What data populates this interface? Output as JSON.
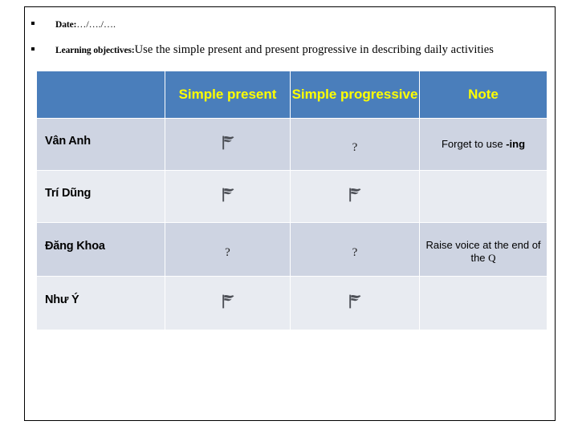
{
  "slide": {
    "bullets": [
      {
        "marker": "square-bullet",
        "label": "Date:",
        "value": "…/…./…."
      },
      {
        "marker": "square-bullet",
        "label": "Learning objectives:",
        "value": "Use the simple present and present progressive in describing daily activities"
      }
    ],
    "table": {
      "headers": [
        "",
        "Simple present",
        "Simple progressive",
        "Note"
      ],
      "header_bg": "#4a7ebb",
      "header_color": "#ffff00",
      "band_dark": "#ced4e2",
      "band_light": "#e8ebf1",
      "rows": [
        {
          "name": "Vân Anh",
          "simple_present": "flag-icon",
          "simple_progressive": "?",
          "note": "Forget to use ",
          "note_bold": "-ing",
          "note_tail": ""
        },
        {
          "name": "Trí Dũng",
          "simple_present": "flag-icon",
          "simple_progressive": "flag-icon",
          "note": "",
          "note_bold": "",
          "note_tail": ""
        },
        {
          "name": "Đăng Khoa",
          "simple_present": "?",
          "simple_progressive": "?",
          "note": "Raise voice at the end of the ",
          "note_bold": "",
          "note_tail": "Q"
        },
        {
          "name": "Như Ý",
          "simple_present": "flag-icon",
          "simple_progressive": "flag-icon",
          "note": "",
          "note_bold": "",
          "note_tail": ""
        }
      ]
    }
  }
}
